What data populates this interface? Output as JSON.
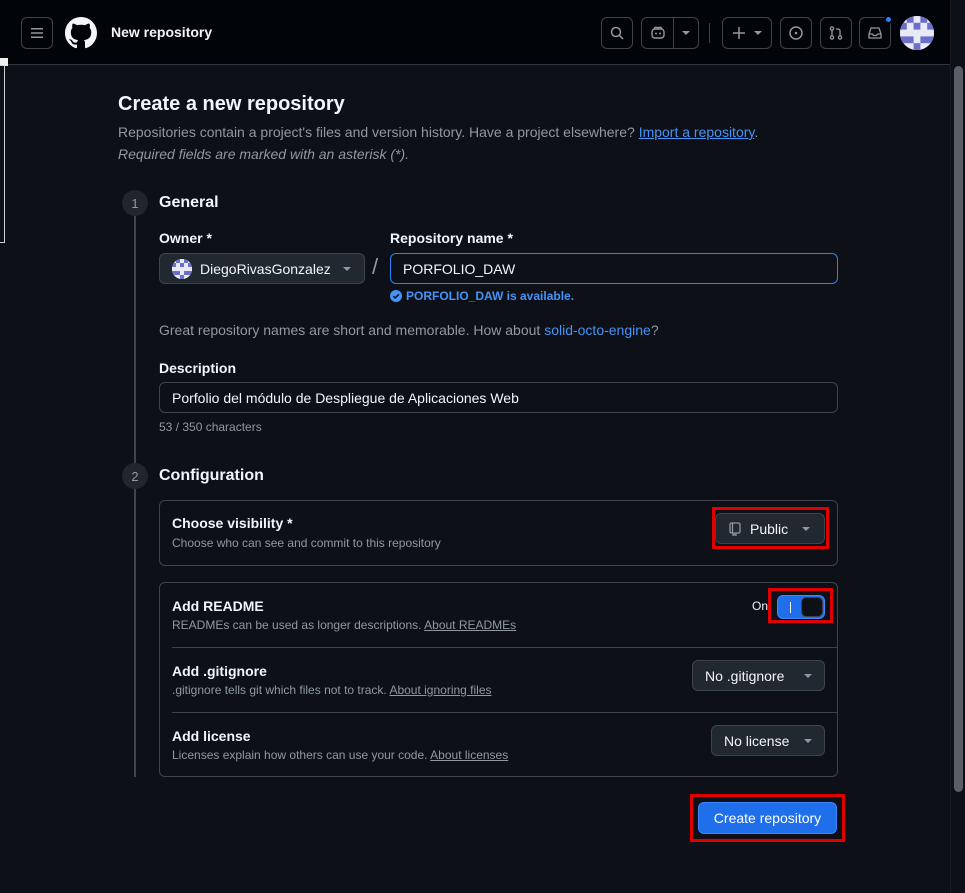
{
  "header": {
    "page_name": "New repository",
    "notification_color": "#2f81f7"
  },
  "page": {
    "title": "Create a new repository",
    "subtitle_prefix": "Repositories contain a project's files and version history. Have a project elsewhere?",
    "import_link": "Import a repository",
    "subtitle_suffix": ".",
    "required_note": "Required fields are marked with an asterisk (*)."
  },
  "general": {
    "step_number": "1",
    "title": "General",
    "owner_label": "Owner *",
    "owner_value": "DiegoRivasGonzalez",
    "slash": "/",
    "repo_name_label": "Repository name *",
    "repo_name_value": "PORFOLIO_DAW",
    "availability": "PORFOLIO_DAW is available.",
    "suggestion_prefix": "Great repository names are short and memorable. How about",
    "suggestion_name": "solid-octo-engine",
    "suggestion_suffix": "?",
    "description_label": "Description",
    "description_value": "Porfolio del módulo de Despliegue de Aplicaciones Web",
    "char_count": "53 / 350 characters"
  },
  "configuration": {
    "step_number": "2",
    "title": "Configuration",
    "visibility_title": "Choose visibility *",
    "visibility_desc": "Choose who can see and commit to this repository",
    "visibility_value": "Public",
    "readme_title": "Add README",
    "readme_desc": "READMEs can be used as longer descriptions.",
    "readme_link": "About READMEs",
    "readme_toggle_label": "On",
    "readme_enabled": true,
    "gitignore_title": "Add .gitignore",
    "gitignore_desc": ".gitignore tells git which files not to track.",
    "gitignore_link": "About ignoring files",
    "gitignore_value": "No .gitignore",
    "license_title": "Add license",
    "license_desc": "Licenses explain how others can use your code.",
    "license_link": "About licenses",
    "license_value": "No license"
  },
  "actions": {
    "create_label": "Create repository"
  },
  "colors": {
    "accent": "#1f6feb",
    "link": "#4493f8",
    "highlight": "#e00000",
    "background": "#0d1117"
  }
}
